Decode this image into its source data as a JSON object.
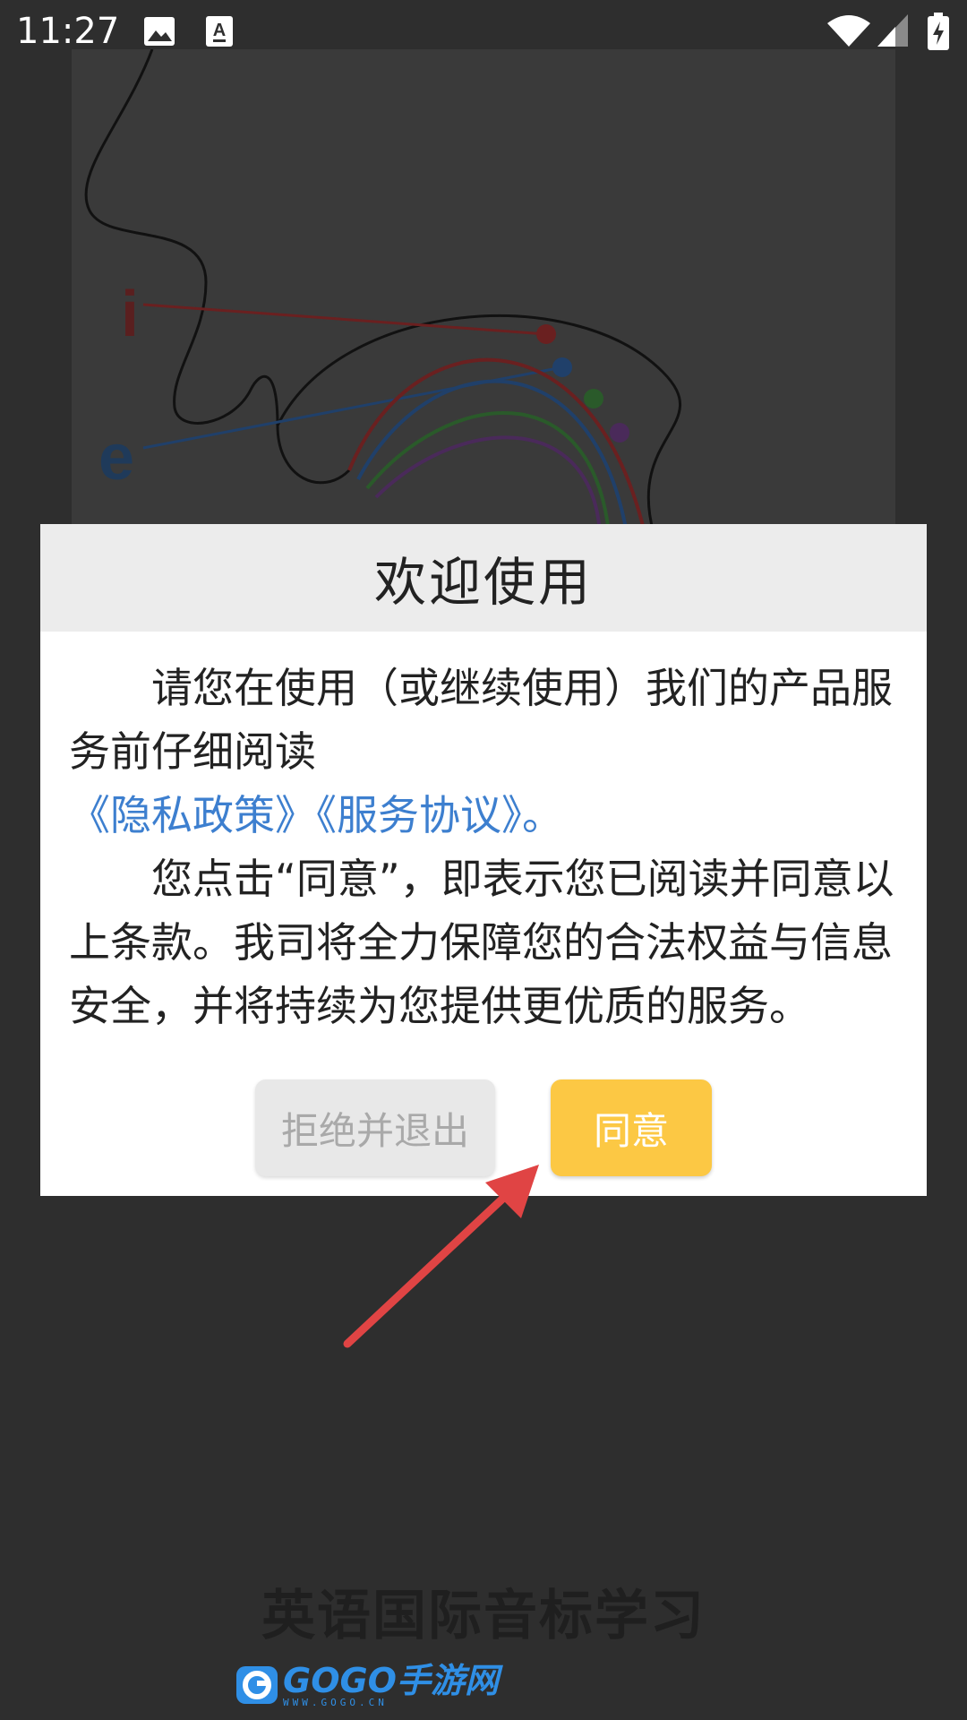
{
  "status_bar": {
    "time": "11:27",
    "icons": [
      "image-icon",
      "font-icon",
      "wifi-icon",
      "signal-icon",
      "battery-charging-icon"
    ]
  },
  "splash": {
    "letters": [
      "i",
      "e"
    ],
    "title": "英语国际音标学习",
    "watermark": {
      "text": "GOGO手游网",
      "url": "WWW.GOGO.CN"
    }
  },
  "dialog": {
    "title": "欢迎使用",
    "intro": "请您在使用（或继续使用）我们的产品服务前仔细阅读",
    "links": "《隐私政策》《服务协议》。",
    "notice": "您点击“同意”，即表示您已阅读并同意以上条款。我司将全力保障您的合法权益与信息安全，并将持续为您提供更优质的服务。",
    "refuse_label": "拒绝并退出",
    "agree_label": "同意"
  },
  "colors": {
    "overlay": "#2f2f2f",
    "link": "#3d7fcf",
    "agree_button": "#fcc844",
    "arrow": "#e04444"
  }
}
